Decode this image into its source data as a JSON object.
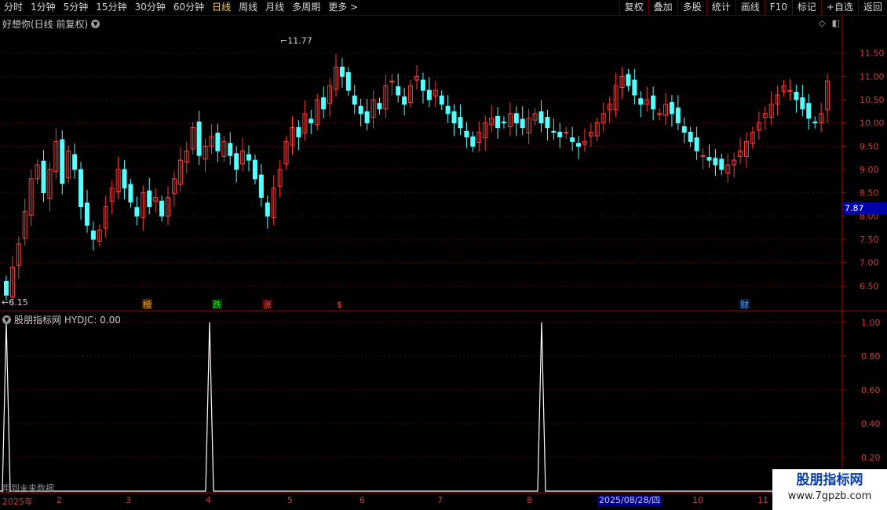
{
  "toolbar": {
    "periods": [
      "分时",
      "1分钟",
      "5分钟",
      "15分钟",
      "30分钟",
      "60分钟",
      "日线",
      "周线",
      "月线",
      "多周期",
      "更多 >"
    ],
    "active_period": "日线",
    "tools": [
      "复权",
      "叠加",
      "多股",
      "统计",
      "画线",
      "F10",
      "标记",
      "+自选",
      "返回"
    ]
  },
  "main_chart": {
    "title": "好想你(日线 前复权)",
    "high_label": "11.77",
    "low_label": "6.15",
    "current_price": "7.87",
    "markers": [
      {
        "text": "榜",
        "color": "#e8a030",
        "bg": "#4a2a00"
      },
      {
        "text": "跌",
        "color": "#30e030",
        "bg": "#003000"
      },
      {
        "text": "涨",
        "color": "#ff4040",
        "bg": "#3a0000"
      },
      {
        "text": "$",
        "color": "#ff4040",
        "bg": "#000000"
      },
      {
        "text": "财",
        "color": "#40a0ff",
        "bg": "#002040"
      }
    ]
  },
  "indicator": {
    "title": "股朋指标网 HYDJC: 0.00",
    "note": "用到未来数据",
    "y_labels": [
      "1.00",
      "0.80",
      "0.60",
      "0.40",
      "0.20"
    ]
  },
  "x_axis": {
    "labels": [
      "2025年",
      "2",
      "3",
      "4",
      "5",
      "6",
      "7",
      "8",
      "10",
      "11"
    ],
    "hover_date": "2025/08/28/四"
  },
  "watermark": {
    "title": "股朋指标网",
    "url": "www.7gpzb.com"
  },
  "chart_data": [
    {
      "type": "candlestick",
      "title": "好想你(日线 前复权)",
      "y_ticks": [
        11.5,
        11.0,
        10.5,
        10.0,
        9.5,
        9.0,
        8.5,
        8.0,
        7.5,
        7.0,
        6.5
      ],
      "ylim": [
        6.0,
        12.0
      ],
      "high": 11.77,
      "low": 6.15,
      "current": 7.87,
      "colors": {
        "up": "#ff3b3b",
        "down": "#54ffff"
      },
      "closes": [
        6.3,
        6.9,
        7.4,
        8.1,
        8.8,
        9.1,
        8.5,
        9.0,
        9.6,
        8.7,
        9.4,
        9.0,
        8.2,
        7.8,
        7.5,
        7.7,
        8.2,
        8.6,
        9.0,
        8.6,
        8.3,
        8.0,
        8.5,
        8.2,
        8.4,
        8.0,
        8.4,
        8.8,
        9.2,
        9.4,
        9.9,
        9.3,
        9.5,
        9.7,
        9.4,
        9.6,
        9.3,
        9.0,
        9.4,
        9.2,
        8.8,
        8.4,
        8.0,
        8.6,
        9.0,
        9.6,
        9.9,
        9.7,
        10.2,
        10.0,
        10.5,
        10.3,
        10.8,
        11.2,
        11.0,
        10.7,
        10.4,
        10.2,
        10.0,
        10.5,
        10.3,
        10.8,
        10.9,
        10.6,
        10.4,
        10.8,
        11.0,
        10.7,
        10.5,
        10.7,
        10.4,
        10.2,
        10.0,
        9.9,
        9.7,
        9.5,
        9.8,
        10.0,
        10.1,
        9.9,
        10.0,
        10.2,
        10.0,
        9.9,
        10.1,
        10.2,
        10.0,
        9.9,
        9.8,
        9.7,
        9.8,
        9.6,
        9.5,
        9.6,
        9.8,
        10.0,
        10.2,
        10.4,
        10.8,
        11.0,
        10.8,
        10.6,
        10.4,
        10.5,
        10.3,
        10.2,
        10.4,
        10.2,
        10.0,
        9.8,
        9.6,
        9.4,
        9.3,
        9.2,
        9.1,
        9.0,
        9.1,
        9.2,
        9.4,
        9.6,
        9.8,
        10.0,
        10.2,
        10.4,
        10.6,
        10.8,
        10.7,
        10.5,
        10.3,
        10.1,
        10.0,
        10.2,
        10.9
      ]
    },
    {
      "type": "line",
      "title": "HYDJC",
      "y_ticks": [
        1.0,
        0.8,
        0.6,
        0.4,
        0.2
      ],
      "ylim": [
        0,
        1.05
      ],
      "series": [
        {
          "name": "HYDJC",
          "spikes_at_x": [
            8,
            267,
            690
          ],
          "spike_value": 1.0,
          "baseline": 0.0
        }
      ]
    }
  ]
}
